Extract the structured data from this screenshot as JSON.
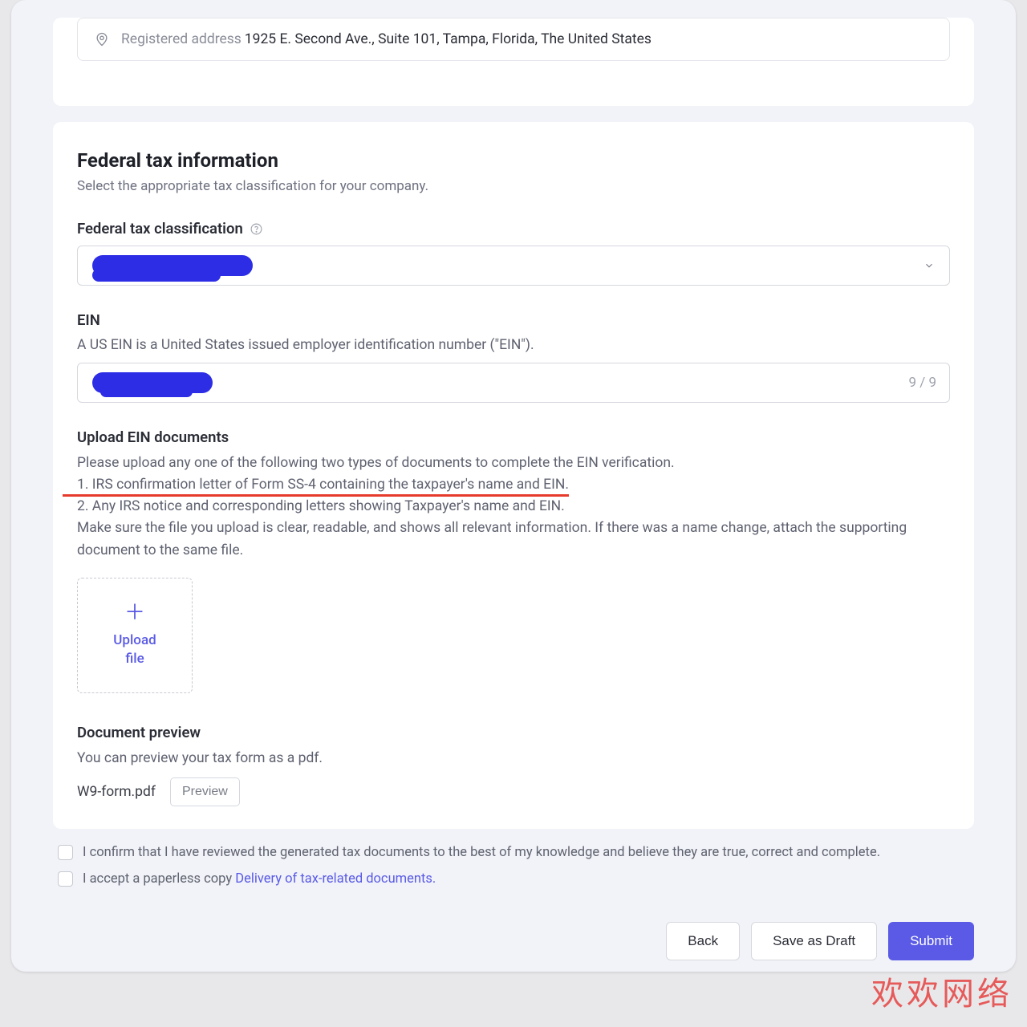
{
  "address": {
    "label": "Registered address",
    "value": "1925 E. Second Ave., Suite 101, Tampa, Florida, The United States"
  },
  "tax": {
    "title": "Federal tax information",
    "subtitle": "Select the appropriate tax classification for your company.",
    "classification_label": "Federal tax classification",
    "ein_label": "EIN",
    "ein_desc": "A US EIN is a United States issued employer identification number (\"EIN\").",
    "ein_counter": "9 / 9",
    "upload_heading": "Upload EIN documents",
    "upload_intro": "Please upload any one of the following two types of documents to complete the EIN verification.",
    "upload_item1": "1. IRS confirmation letter of Form SS-4 containing the taxpayer's name and EIN.",
    "upload_item2": "2. Any IRS notice and corresponding letters showing Taxpayer's name and EIN.",
    "upload_note": "Make sure the file you upload is clear, readable, and shows all relevant information. If there was a name change, attach the supporting document to the same file.",
    "upload_button_label": "Upload file",
    "preview_heading": "Document preview",
    "preview_sub": "You can preview your tax form as a pdf.",
    "preview_filename": "W9-form.pdf",
    "preview_button": "Preview"
  },
  "confirmations": {
    "confirm_text": "I confirm that I have reviewed the generated tax documents to the best of my knowledge and believe they are true, correct and complete.",
    "paperless_text": "I accept a paperless copy ",
    "paperless_link": "Delivery of tax-related documents."
  },
  "buttons": {
    "back": "Back",
    "save_draft": "Save as Draft",
    "submit": "Submit"
  },
  "watermark": "欢欢网络"
}
